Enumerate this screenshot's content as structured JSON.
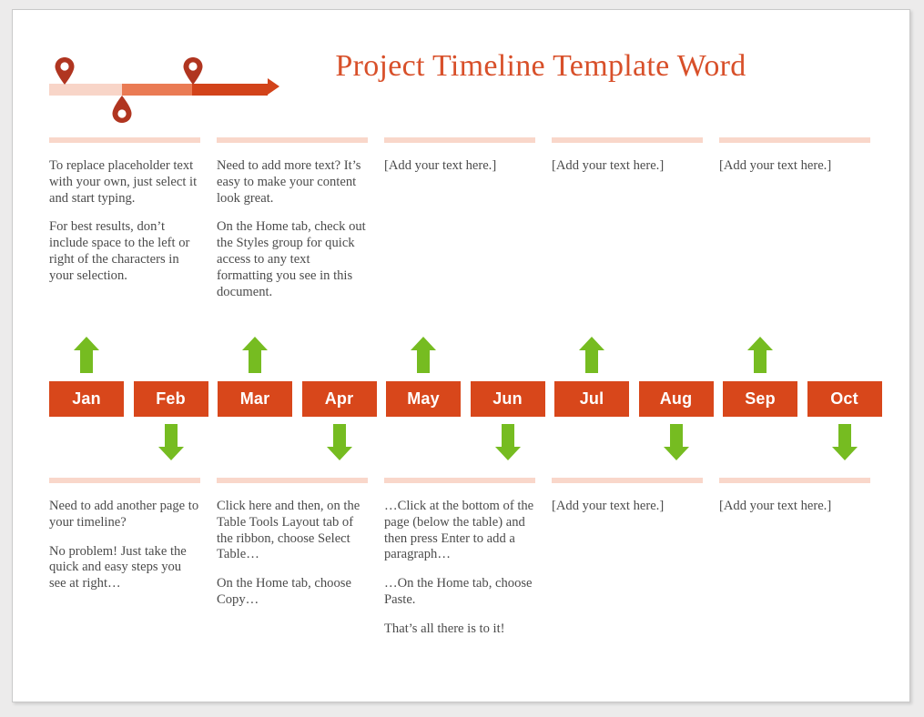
{
  "document": {
    "title": "Project Timeline Template Word",
    "title_color": "#d8502a"
  },
  "timeline_graphic": {
    "name": "timeline-arrow-graphic",
    "segments": [
      {
        "label": "segment-1",
        "color": "#f8d5c8"
      },
      {
        "label": "segment-2",
        "color": "#ea7b54"
      },
      {
        "label": "segment-3",
        "color": "#d2431a"
      }
    ],
    "markers": [
      {
        "name": "map-pin-1",
        "orientation": "down"
      },
      {
        "name": "map-pin-2",
        "orientation": "down"
      },
      {
        "name": "map-pin-3",
        "orientation": "up"
      }
    ],
    "marker_color": "#b03520"
  },
  "top_columns": [
    {
      "name": "column-1",
      "paragraphs": [
        "To replace placeholder text with your own, just select it and start typing.",
        "For best results, don’t include space to the left or right of the characters in your selection."
      ]
    },
    {
      "name": "column-2",
      "paragraphs": [
        "Need to add more text? It’s easy to make your content look great.",
        "On the Home tab, check out the Styles group for quick access to any text formatting you see in this document."
      ]
    },
    {
      "name": "column-3",
      "paragraphs": [
        "[Add your text here.]"
      ]
    },
    {
      "name": "column-4",
      "paragraphs": [
        "[Add your text here.]"
      ]
    },
    {
      "name": "column-5",
      "paragraphs": [
        "[Add your text here.]"
      ]
    }
  ],
  "months": [
    {
      "label": "Jan",
      "arrow": "up"
    },
    {
      "label": "Feb",
      "arrow": "down"
    },
    {
      "label": "Mar",
      "arrow": "up"
    },
    {
      "label": "Apr",
      "arrow": "down"
    },
    {
      "label": "May",
      "arrow": "up"
    },
    {
      "label": "Jun",
      "arrow": "down"
    },
    {
      "label": "Jul",
      "arrow": "up"
    },
    {
      "label": "Aug",
      "arrow": "down"
    },
    {
      "label": "Sep",
      "arrow": "up"
    },
    {
      "label": "Oct",
      "arrow": "down"
    }
  ],
  "month_box_color": "#d8471b",
  "arrow_color": "#76bc21",
  "bottom_columns": [
    {
      "name": "column-1",
      "paragraphs": [
        "Need to add another page to your timeline?",
        "No problem! Just take the quick and easy steps you see at right…"
      ]
    },
    {
      "name": "column-2",
      "paragraphs": [
        "Click here and then, on the Table Tools Layout tab of the ribbon, choose Select Table…",
        "On the Home tab, choose Copy…"
      ]
    },
    {
      "name": "column-3",
      "paragraphs": [
        "…Click at the bottom of the page (below the table) and then press Enter to add a paragraph…",
        "…On the Home tab, choose Paste.",
        "That’s all there is to it!"
      ]
    },
    {
      "name": "column-4",
      "paragraphs": [
        "[Add your text here.]"
      ]
    },
    {
      "name": "column-5",
      "paragraphs": [
        "[Add your text here.]"
      ]
    }
  ]
}
